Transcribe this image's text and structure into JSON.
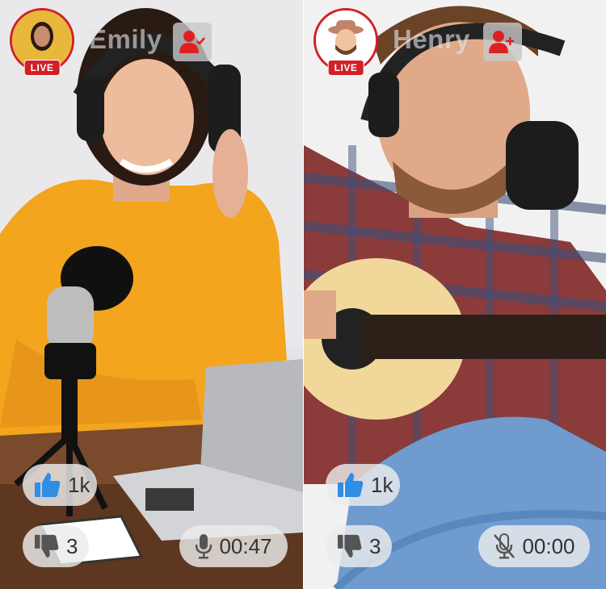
{
  "streams": [
    {
      "username": "Emily",
      "live_label": "LIVE",
      "follow_state": "followed",
      "likes": "1k",
      "dislikes": "3",
      "timer": "00:47",
      "mic": "on",
      "icons": {
        "like": "thumbs-up-icon",
        "dislike": "thumbs-down-icon",
        "mic": "microphone-icon",
        "follow": "user-check-icon"
      }
    },
    {
      "username": "Henry",
      "live_label": "LIVE",
      "follow_state": "not-followed",
      "likes": "1k",
      "dislikes": "3",
      "timer": "00:00",
      "mic": "muted",
      "icons": {
        "like": "thumbs-up-icon",
        "dislike": "thumbs-down-icon",
        "mic": "microphone-muted-icon",
        "follow": "user-plus-icon"
      }
    }
  ],
  "colors": {
    "live": "#d31f26",
    "like": "#2f8de4",
    "follow": "#e02020",
    "pill": "#ebebeb"
  }
}
